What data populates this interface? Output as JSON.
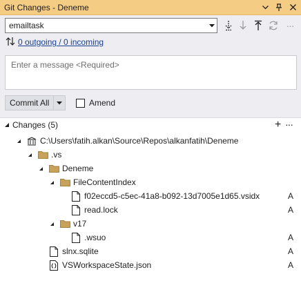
{
  "window": {
    "title": "Git Changes - Deneme",
    "titlebar_icons": [
      "chevron-down-icon",
      "pin-icon",
      "close-icon"
    ]
  },
  "branch": {
    "name": "emailtask"
  },
  "git_actions": [
    "fetch-icon",
    "pull-icon",
    "push-icon",
    "sync-icon",
    "more-icon"
  ],
  "sync": {
    "text": "0 outgoing / 0 incoming"
  },
  "message": {
    "placeholder": "Enter a message <Required>"
  },
  "commit": {
    "label": "Commit All",
    "amend_label": "Amend",
    "amend_checked": false
  },
  "changes": {
    "label": "Changes (5)",
    "items": [
      {
        "name": "C:\\Users\\fatih.alkan\\Source\\Repos\\alkanfatih\\Deneme",
        "kind": "repo",
        "status": ""
      },
      {
        "name": ".vs",
        "kind": "folder",
        "status": ""
      },
      {
        "name": "Deneme",
        "kind": "folder",
        "status": ""
      },
      {
        "name": "FileContentIndex",
        "kind": "folder",
        "status": ""
      },
      {
        "name": "f02eccd5-c5ec-41a8-b092-13d7005e1d65.vsidx",
        "kind": "file",
        "status": "A"
      },
      {
        "name": "read.lock",
        "kind": "file",
        "status": "A"
      },
      {
        "name": "v17",
        "kind": "folder",
        "status": ""
      },
      {
        "name": ".wsuo",
        "kind": "file",
        "status": "A"
      },
      {
        "name": "slnx.sqlite",
        "kind": "file",
        "status": "A"
      },
      {
        "name": "VSWorkspaceState.json",
        "kind": "json",
        "status": "A"
      }
    ]
  },
  "colors": {
    "titlebar": "#f5cc84",
    "panel": "#eeeef2",
    "link": "#1a3f8f",
    "folder": "#c8a15a"
  }
}
